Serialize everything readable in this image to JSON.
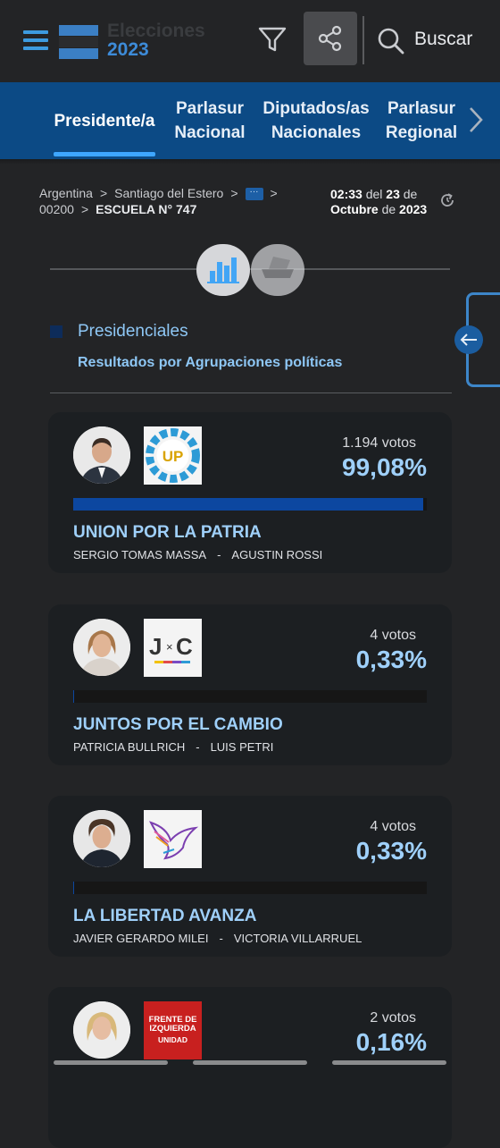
{
  "header": {
    "logo_line1": "Elecciones",
    "logo_line2": "2023",
    "search_label": "Buscar"
  },
  "tabs": [
    {
      "line1": "Presidente/a",
      "line2": ""
    },
    {
      "line1": "Parlasur",
      "line2": "Nacional"
    },
    {
      "line1": "Diputados/as",
      "line2": "Nacionales"
    },
    {
      "line1": "Parlasur",
      "line2": "Regional"
    }
  ],
  "breadcrumb": {
    "country": "Argentina",
    "province": "Santiago del Estero",
    "more": "···",
    "section": "00200",
    "school": "ESCUELA N° 747"
  },
  "datetime": {
    "time": "02:33",
    "del": "del",
    "day": "23",
    "de1": "de",
    "month": "Octubre",
    "de2": "de",
    "year": "2023"
  },
  "section": {
    "title": "Presidenciales",
    "subtitle": "Resultados por Agrupaciones políticas"
  },
  "results": [
    {
      "votes": "1.194 votos",
      "percent": "99,08%",
      "share": 99.08,
      "party": "UNION POR LA PATRIA",
      "candidate1": "SERGIO TOMAS MASSA",
      "separator": "-",
      "candidate2": "AGUSTIN ROSSI"
    },
    {
      "votes": "4 votos",
      "percent": "0,33%",
      "share": 0.33,
      "party": "JUNTOS POR EL CAMBIO",
      "candidate1": "PATRICIA BULLRICH",
      "separator": "-",
      "candidate2": "LUIS PETRI"
    },
    {
      "votes": "4 votos",
      "percent": "0,33%",
      "share": 0.33,
      "party": "LA LIBERTAD AVANZA",
      "candidate1": "JAVIER GERARDO MILEI",
      "separator": "-",
      "candidate2": "VICTORIA VILLARRUEL"
    },
    {
      "votes": "2 votos",
      "percent": "0,16%",
      "share": 0.16,
      "party": "",
      "candidate1": "",
      "separator": "",
      "candidate2": ""
    }
  ],
  "logos": {
    "up": "UP",
    "jxc_j": "J",
    "jxc_x": "×",
    "jxc_c": "C",
    "fit_line1": "FRENTE DE",
    "fit_line2": "IZQUIERDA",
    "fit_line3": "UNIDAD"
  },
  "colors": {
    "accent": "#3d9be0",
    "tabs_bg": "#0c4a85",
    "bar_fill": "#0c47a0",
    "party_text": "#9fd0fa"
  }
}
